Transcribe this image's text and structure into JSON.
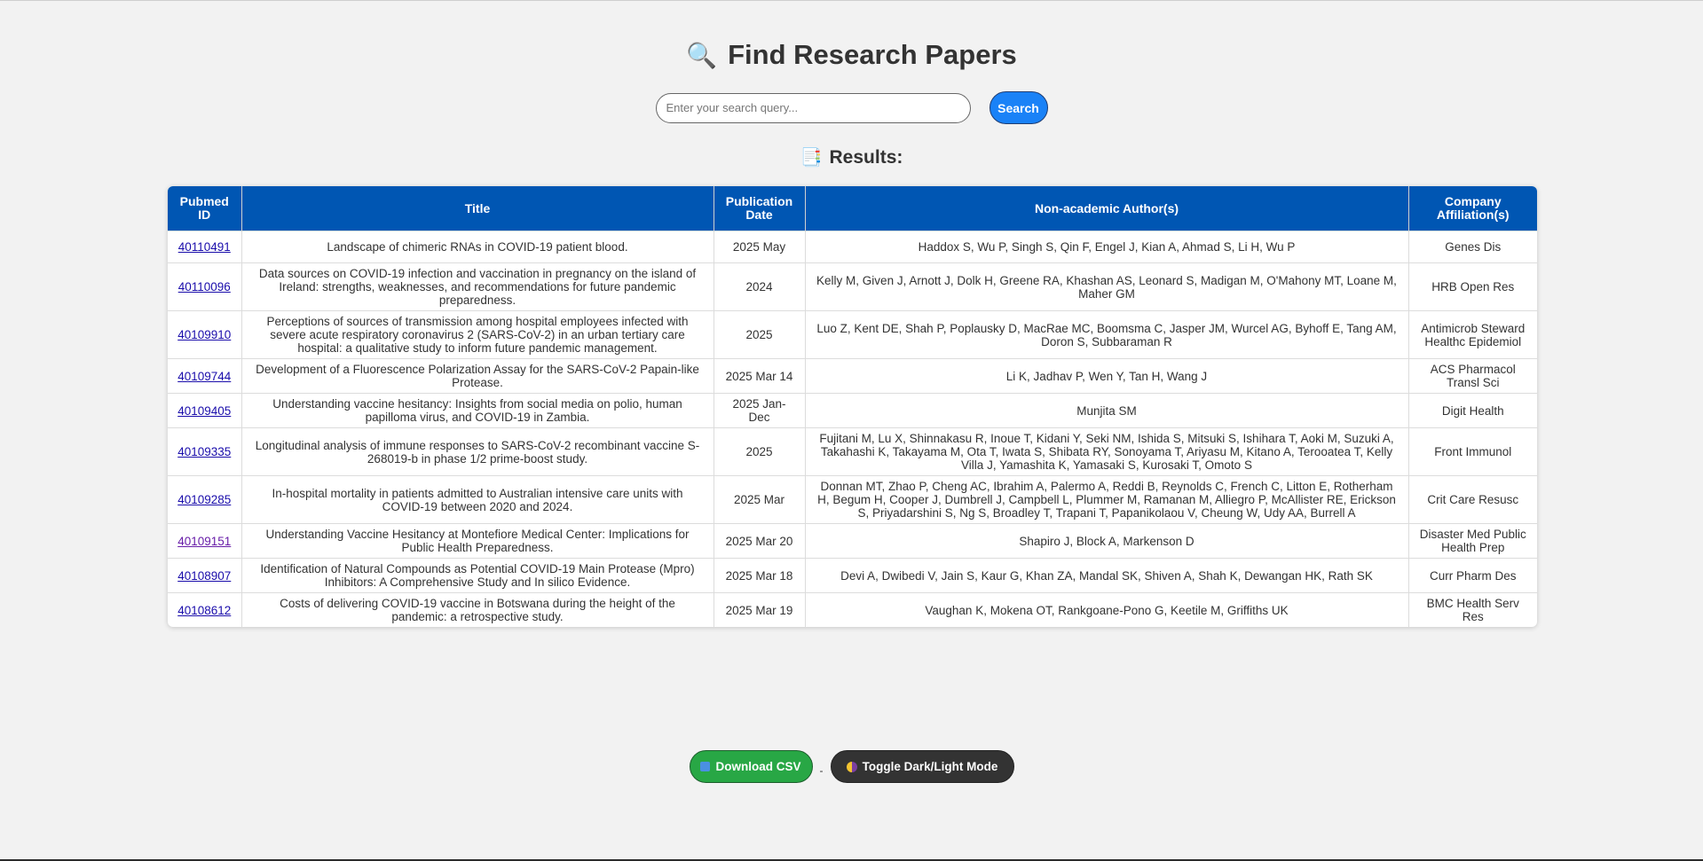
{
  "header": {
    "title": "Find Research Papers",
    "icon": "magnifier-icon"
  },
  "search": {
    "placeholder": "Enter your search query...",
    "value": "",
    "button_label": "Search"
  },
  "results": {
    "heading": "Results:",
    "icon": "page-icon"
  },
  "table": {
    "columns": [
      "Pubmed ID",
      "Title",
      "Publication Date",
      "Non-academic Author(s)",
      "Company Affiliation(s)"
    ],
    "rows": [
      {
        "id": "40110491",
        "title": "Landscape of chimeric RNAs in COVID-19 patient blood.",
        "date": "2025 May",
        "authors": "Haddox S, Wu P, Singh S, Qin F, Engel J, Kian A, Ahmad S, Li H, Wu P",
        "company": "Genes Dis"
      },
      {
        "id": "40110096",
        "title": "Data sources on COVID-19 infection and vaccination in pregnancy on the island of Ireland: strengths, weaknesses, and recommendations for future pandemic preparedness.",
        "date": "2024",
        "authors": "Kelly M, Given J, Arnott J, Dolk H, Greene RA, Khashan AS, Leonard S, Madigan M, O'Mahony MT, Loane M, Maher GM",
        "company": "HRB Open Res"
      },
      {
        "id": "40109910",
        "title": "Perceptions of sources of transmission among hospital employees infected with severe acute respiratory coronavirus 2 (SARS-CoV-2) in an urban tertiary care hospital: a qualitative study to inform future pandemic management.",
        "date": "2025",
        "authors": "Luo Z, Kent DE, Shah P, Poplausky D, MacRae MC, Boomsma C, Jasper JM, Wurcel AG, Byhoff E, Tang AM, Doron S, Subbaraman R",
        "company": "Antimicrob Steward Healthc Epidemiol"
      },
      {
        "id": "40109744",
        "title": "Development of a Fluorescence Polarization Assay for the SARS-CoV-2 Papain-like Protease.",
        "date": "2025 Mar 14",
        "authors": "Li K, Jadhav P, Wen Y, Tan H, Wang J",
        "company": "ACS Pharmacol Transl Sci"
      },
      {
        "id": "40109405",
        "title": "Understanding vaccine hesitancy: Insights from social media on polio, human papilloma virus, and COVID-19 in Zambia.",
        "date": "2025 Jan-Dec",
        "authors": "Munjita SM",
        "company": "Digit Health"
      },
      {
        "id": "40109335",
        "title": "Longitudinal analysis of immune responses to SARS-CoV-2 recombinant vaccine S-268019-b in phase 1/2 prime-boost study.",
        "date": "2025",
        "authors": "Fujitani M, Lu X, Shinnakasu R, Inoue T, Kidani Y, Seki NM, Ishida S, Mitsuki S, Ishihara T, Aoki M, Suzuki A, Takahashi K, Takayama M, Ota T, Iwata S, Shibata RY, Sonoyama T, Ariyasu M, Kitano A, Terooatea T, Kelly Villa J, Yamashita K, Yamasaki S, Kurosaki T, Omoto S",
        "company": "Front Immunol"
      },
      {
        "id": "40109285",
        "title": "In-hospital mortality in patients admitted to Australian intensive care units with COVID-19 between 2020 and 2024.",
        "date": "2025 Mar",
        "authors": "Donnan MT, Zhao P, Cheng AC, Ibrahim A, Palermo A, Reddi B, Reynolds C, French C, Litton E, Rotherham H, Begum H, Cooper J, Dumbrell J, Campbell L, Plummer M, Ramanan M, Alliegro P, McAllister RE, Erickson S, Priyadarshini S, Ng S, Broadley T, Trapani T, Papanikolaou V, Cheung W, Udy AA, Burrell A",
        "company": "Crit Care Resusc"
      },
      {
        "id": "40109151",
        "title": "Understanding Vaccine Hesitancy at Montefiore Medical Center: Implications for Public Health Preparedness.",
        "date": "2025 Mar 20",
        "authors": "Shapiro J, Block A, Markenson D",
        "company": "Disaster Med Public Health Prep",
        "visited": true
      },
      {
        "id": "40108907",
        "title": "Identification of Natural Compounds as Potential COVID-19 Main Protease (Mpro) Inhibitors: A Comprehensive Study and In silico Evidence.",
        "date": "2025 Mar 18",
        "authors": "Devi A, Dwibedi V, Jain S, Kaur G, Khan ZA, Mandal SK, Shiven A, Shah K, Dewangan HK, Rath SK",
        "company": "Curr Pharm Des"
      },
      {
        "id": "40108612",
        "title": "Costs of delivering COVID-19 vaccine in Botswana during the height of the pandemic: a retrospective study.",
        "date": "2025 Mar 19",
        "authors": "Vaughan K, Mokena OT, Rankgoane-Pono G, Keetile M, Griffiths UK",
        "company": "BMC Health Serv Res"
      }
    ]
  },
  "actions": {
    "download_label": "Download CSV",
    "separator": "-",
    "toggle_label": "Toggle Dark/Light Mode"
  },
  "colors": {
    "header_bg": "#0056b3",
    "search_btn": "#1a82f7",
    "download_btn": "#28a745",
    "toggle_btn": "#333333"
  }
}
